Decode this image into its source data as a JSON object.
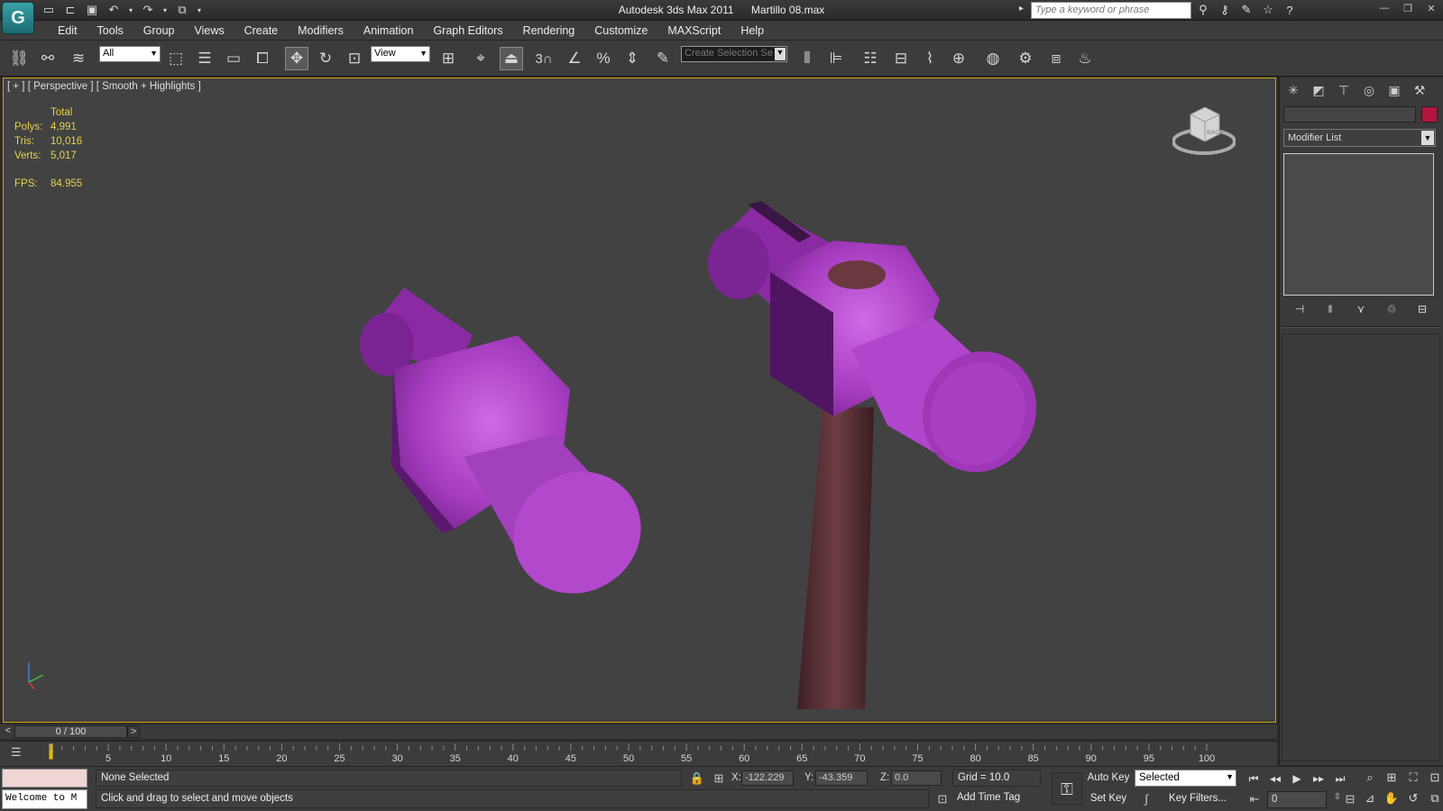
{
  "window": {
    "app_title": "Autodesk 3ds Max  2011",
    "file_name": "Martillo 08.max",
    "search_placeholder": "Type a keyword or phrase"
  },
  "menu": [
    "Edit",
    "Tools",
    "Group",
    "Views",
    "Create",
    "Modifiers",
    "Animation",
    "Graph Editors",
    "Rendering",
    "Customize",
    "MAXScript",
    "Help"
  ],
  "toolbar": {
    "selection_filter": "All",
    "ref_coord_system": "View",
    "named_selection_placeholder": "Create Selection Se",
    "snap_toggle_label": "3"
  },
  "viewport": {
    "label": "[ + ] [ Perspective ] [ Smooth + Highlights ]",
    "stats": {
      "header": "Total",
      "polys_label": "Polys:",
      "polys": "4,991",
      "tris_label": "Tris:",
      "tris": "10,016",
      "verts_label": "Verts:",
      "verts": "5,017",
      "fps_label": "FPS:",
      "fps": "84.955"
    },
    "viewcube_label": "BACK",
    "object_color": "#a53cbf",
    "handle_color": "#5a3338"
  },
  "command_panel": {
    "modifier_list": "Modifier List",
    "object_color": "#b41540"
  },
  "timeline": {
    "frame_display": "0 / 100",
    "ticks": [
      "5",
      "10",
      "15",
      "20",
      "25",
      "30",
      "35",
      "40",
      "45",
      "50",
      "55",
      "60",
      "65",
      "70",
      "75",
      "80",
      "85",
      "90",
      "95",
      "100"
    ]
  },
  "status": {
    "maxscript_output": "Welcome to M",
    "selection": "None Selected",
    "prompt": "Click and drag to select and move objects",
    "x_label": "X:",
    "x_value": "-122.229",
    "y_label": "Y:",
    "y_value": "-43.359",
    "z_label": "Z:",
    "z_value": "0.0",
    "grid": "Grid = 10.0",
    "add_time_tag": "Add Time Tag",
    "auto_key": "Auto Key",
    "set_key": "Set Key",
    "key_mode": "Selected",
    "key_filters": "Key Filters...",
    "current_frame": "0"
  }
}
